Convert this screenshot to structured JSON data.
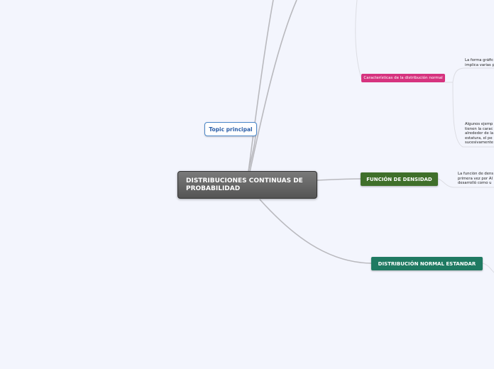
{
  "central_topic": "DISTRIBUCIONES CONTINUAS DE PROBABILIDAD",
  "topic_principal": "Topic principal",
  "subtopics": {
    "caracteristicas": "Características de la distribución normal",
    "funcion_densidad": "FUNCIÓN DE DENSIDAD",
    "normal_estandar": "DISTRIBUCIÓN NORMAL ESTANDAR"
  },
  "notes": {
    "forma_grafica": "La forma gráfic\nimplica varias p",
    "algunos_ejemplos": "Algunos ejemp\ntienen la carac\nalrededor de la\nestatura, el pe\nsucesivamente",
    "funcion_texto": "La función de dens\nprimera vez por Al\ndesarrolló como u"
  },
  "colors": {
    "background": "#f3f5fd",
    "central": "#5f5f5f",
    "topic_border": "#4a86c8",
    "pink": "#d6337f",
    "green": "#3f6f2a",
    "teal": "#1f7a62",
    "link": "#b9b9be"
  }
}
